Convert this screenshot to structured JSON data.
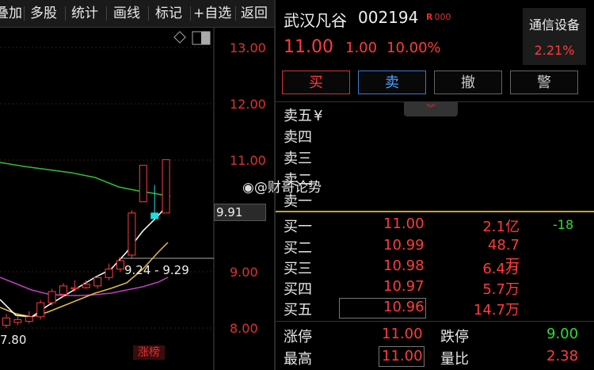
{
  "toolbar": {
    "items": [
      "叠加",
      "多股",
      "统计",
      "画线",
      "标记",
      "+自选",
      "返回"
    ]
  },
  "chart": {
    "price_ticks": [
      "13.00",
      "12.00",
      "11.00",
      "9.00",
      "8.00"
    ],
    "current_price_label": "9.91",
    "range_label": "9.24 - 9.29",
    "low_label": "7.80",
    "limit_up_tag": "涨榜",
    "colors": {
      "up": "#ff3b3b",
      "flat": "#22dddd",
      "ma5": "#ffffff",
      "ma10": "#e0c040",
      "ma20": "#c040c0",
      "ma60": "#30c030"
    }
  },
  "chart_data": {
    "type": "candlestick",
    "ylim": [
      7.6,
      13.4
    ],
    "candles": [
      {
        "o": 8.05,
        "c": 8.18,
        "h": 8.25,
        "l": 8.0
      },
      {
        "o": 8.1,
        "c": 8.15,
        "h": 8.22,
        "l": 8.05
      },
      {
        "o": 8.12,
        "c": 8.2,
        "h": 8.3,
        "l": 8.08
      },
      {
        "o": 8.2,
        "c": 8.45,
        "h": 8.5,
        "l": 8.15
      },
      {
        "o": 8.45,
        "c": 8.65,
        "h": 8.7,
        "l": 8.4
      },
      {
        "o": 8.6,
        "c": 8.75,
        "h": 8.8,
        "l": 8.55
      },
      {
        "o": 8.7,
        "c": 8.72,
        "h": 8.85,
        "l": 8.65
      },
      {
        "o": 8.72,
        "c": 8.78,
        "h": 8.85,
        "l": 8.7
      },
      {
        "o": 8.75,
        "c": 8.9,
        "h": 8.95,
        "l": 8.7
      },
      {
        "o": 8.9,
        "c": 9.05,
        "h": 9.15,
        "l": 8.85
      },
      {
        "o": 9.05,
        "c": 9.2,
        "h": 9.25,
        "l": 9.0
      },
      {
        "o": 9.3,
        "c": 10.05,
        "h": 10.1,
        "l": 9.25
      },
      {
        "o": 10.25,
        "c": 10.9,
        "h": 10.9,
        "l": 10.25
      },
      {
        "o": 9.95,
        "c": 10.05,
        "h": 10.55,
        "l": 9.95
      },
      {
        "o": 10.05,
        "c": 11.0,
        "h": 11.0,
        "l": 10.05
      }
    ]
  },
  "quote": {
    "name": "武汉凡谷",
    "code": "002194",
    "badge": "R",
    "badge_suffix": "000",
    "price": "11.00",
    "change": "1.00",
    "change_pct": "10.00%",
    "sector_name": "通信设备",
    "sector_pct": "2.21%",
    "buttons": {
      "buy": "买",
      "sell": "卖",
      "cancel": "撤",
      "alert": "警"
    },
    "sell_levels": [
      "卖五",
      "卖四",
      "卖三",
      "卖二",
      "卖一"
    ],
    "sell_currency": "¥",
    "buy_levels": [
      {
        "label": "买一",
        "price": "11.00",
        "vol": "2.1亿",
        "chg": "-18"
      },
      {
        "label": "买二",
        "price": "10.99",
        "vol": "48.7万",
        "chg": ""
      },
      {
        "label": "买三",
        "price": "10.98",
        "vol": "6.4万",
        "chg": ""
      },
      {
        "label": "买四",
        "price": "10.97",
        "vol": "5.7万",
        "chg": ""
      },
      {
        "label": "买五",
        "price": "10.96",
        "vol": "14.7万",
        "chg": ""
      }
    ],
    "stats": {
      "limit_up_label": "涨停",
      "limit_up": "11.00",
      "limit_down_label": "跌停",
      "limit_down": "9.00",
      "high_label": "最高",
      "high": "11.00",
      "vol_ratio_label": "量比",
      "vol_ratio": "2.38"
    }
  },
  "watermark": "@财哥论势"
}
